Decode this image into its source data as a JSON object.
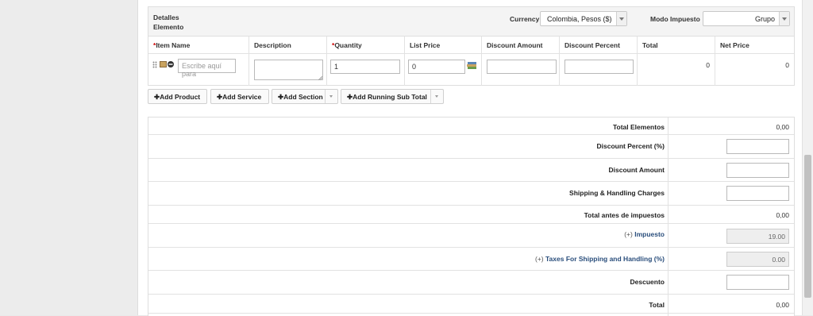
{
  "line_items": {
    "header": {
      "title": "Detalles Elemento",
      "currency_label": "Currency",
      "currency_value": "Colombia, Pesos ($)",
      "tax_mode_label": "Modo Impuesto",
      "tax_mode_value": "Grupo"
    },
    "columns": [
      {
        "label": "Item Name",
        "required": true
      },
      {
        "label": "Description",
        "required": false
      },
      {
        "label": "Quantity",
        "required": true
      },
      {
        "label": "List Price",
        "required": false
      },
      {
        "label": "Discount Amount",
        "required": false
      },
      {
        "label": "Discount Percent",
        "required": false
      },
      {
        "label": "Total",
        "required": false
      },
      {
        "label": "Net Price",
        "required": false
      }
    ],
    "row": {
      "item_name_placeholder": "Escribe aquí para",
      "quantity": "1",
      "list_price": "0",
      "total": "0",
      "net_price": "0"
    }
  },
  "buttons": {
    "add_product": "Add Product",
    "add_service": "Add Service",
    "add_section": "Add Section",
    "add_running_sub_total": "Add Running Sub Total"
  },
  "totals": {
    "total_elementos": {
      "label": "Total Elementos",
      "value": "0,00"
    },
    "discount_percent": {
      "label": "Discount Percent (%)"
    },
    "discount_amount": {
      "label": "Discount Amount"
    },
    "shipping": {
      "label": "Shipping & Handling Charges"
    },
    "antes_impuestos": {
      "label": "Total antes de impuestos",
      "value": "0,00"
    },
    "impuesto": {
      "prefix": "(+)",
      "label": "Impuesto",
      "value": "19.00"
    },
    "taxes_shipping": {
      "prefix": "(+)",
      "label": "Taxes For Shipping and Handling (%)",
      "value": "0.00"
    },
    "descuento": {
      "label": "Descuento"
    },
    "total": {
      "label": "Total",
      "value": "0,00"
    }
  },
  "colors": {
    "required": "#cc0000",
    "link": "#2a4e7c"
  },
  "icons": [
    "drag-handle-icon",
    "product-image-icon",
    "remove-icon",
    "price-book-icon",
    "plus-icon",
    "chevron-down-icon"
  ]
}
